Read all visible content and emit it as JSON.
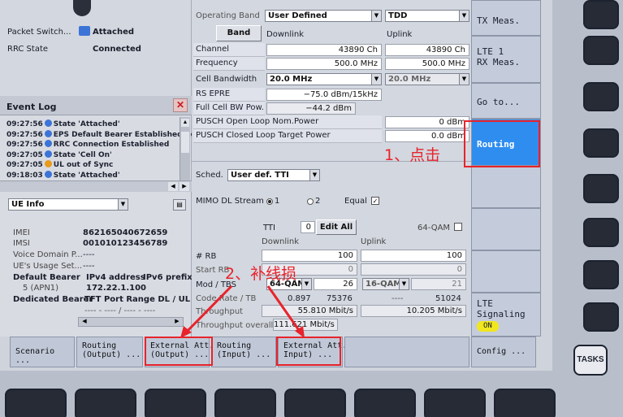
{
  "left_top": {
    "packet_switch_label": "Packet Switch...",
    "packet_switch_value": "Attached",
    "rrc_state_label": "RRC State",
    "rrc_state_value": "Connected"
  },
  "event_log": {
    "title": "Event Log",
    "items": [
      {
        "time": "09:27:56",
        "text": "State 'Attached'",
        "color": "#3b74d6"
      },
      {
        "time": "09:27:56",
        "text": "EPS Default Bearer Established, Ic",
        "color": "#3b74d6"
      },
      {
        "time": "09:27:56",
        "text": "RRC Connection Established",
        "color": "#3b74d6"
      },
      {
        "time": "09:27:05",
        "text": "State 'Cell On'",
        "color": "#3b74d6"
      },
      {
        "time": "09:27:05",
        "text": "UL out of Sync",
        "color": "#e89a1a"
      },
      {
        "time": "09:18:03",
        "text": "State 'Attached'",
        "color": "#3b74d6"
      }
    ]
  },
  "ue_info": {
    "selector": "UE Info",
    "imei_label": "IMEI",
    "imei_value": "862165040672659",
    "imsi_label": "IMSI",
    "imsi_value": "001010123456789",
    "voice_label": "Voice Domain P...",
    "voice_value": "----",
    "usage_label": "UE's Usage Set...",
    "usage_value": "----",
    "default_bearer_label": "Default Bearer",
    "ipv4_header": "IPv4 address",
    "ipv6_header": "IPv6 prefix",
    "apn_label": "5 (APN1)",
    "apn_ipv4": "172.22.1.100",
    "dedicated_label": "Dedicated Bearer",
    "tft_header": "TFT Port Range DL / UL",
    "dashes_row": "----  -  ----   /  ----  -  ----"
  },
  "operating_band": {
    "label": "Operating Band",
    "value": "User Defined",
    "mode": "TDD"
  },
  "band_def_button": "Band Def.",
  "downlink_header": "Downlink",
  "uplink_header": "Uplink",
  "channel": {
    "label": "Channel",
    "dl": "43890  Ch",
    "ul": "43890  Ch"
  },
  "frequency": {
    "label": "Frequency",
    "dl": "500.0  MHz",
    "ul": "500.0  MHz"
  },
  "bandwidth": {
    "label": "Cell Bandwidth",
    "dl": "20.0 MHz",
    "ul": "20.0 MHz"
  },
  "rs_epre": {
    "label": "RS EPRE",
    "value": "−75.0  dBm/15kHz"
  },
  "full_cell_bw": {
    "label": "Full Cell BW Pow.",
    "value": "−44.2  dBm"
  },
  "pusch_open": {
    "label": "PUSCH Open Loop Nom.Power",
    "value": "0 dBm"
  },
  "pusch_closed": {
    "label": "PUSCH Closed Loop Target Power",
    "value": "0.0 dBm"
  },
  "sched": {
    "label": "Sched.",
    "value": "User def. TTI"
  },
  "mimo": {
    "label": "MIMO DL Stream",
    "opt1": "1",
    "opt2": "2",
    "equal": "Equal"
  },
  "tti": {
    "label": "TTI",
    "value": "0",
    "edit_all": "Edit All",
    "qam64": "64-QAM"
  },
  "rb_table": {
    "downlink": "Downlink",
    "uplink": "Uplink",
    "rb_label": "# RB",
    "rb_dl": "100",
    "rb_ul": "100",
    "start_rb_label": "Start RB",
    "start_dl": "0",
    "start_ul": "0",
    "mod_label": "Mod / TBS",
    "mod_dl": "64-QAM",
    "tbs_dl": "26",
    "mod_ul": "16-QAM",
    "tbs_ul": "21",
    "code_label": "Code Rate / TB",
    "code_dl": "0.897",
    "tb_dl": "75376",
    "code_ul": "----",
    "tb_ul": "51024",
    "throughput_label": "Throughput",
    "throughput_dl": "55.810  Mbit/s",
    "throughput_ul": "10.205  Mbit/s",
    "overall_label": "Throughput overall",
    "overall_value": "111.621  Mbit/s"
  },
  "side_menu": {
    "tx_meas": "TX Meas.",
    "lte1": "LTE 1\nRX Meas.",
    "goto": "Go to...",
    "routing": "Routing",
    "lte_signaling": "LTE\nSignaling",
    "on_badge": "ON",
    "config": "Config ..."
  },
  "softkeys": {
    "scenario": "Scenario ...",
    "routing_out": "Routing\n(Output) ...",
    "ext_att_out": "External Att.\n(Output) ...",
    "routing_in": "Routing\n(Input) ...",
    "ext_att_in": "External Att.\nInput) ..."
  },
  "tasks_button": "TASKS",
  "annotations": {
    "step1": "1、点击",
    "step2": "2、补线损"
  }
}
